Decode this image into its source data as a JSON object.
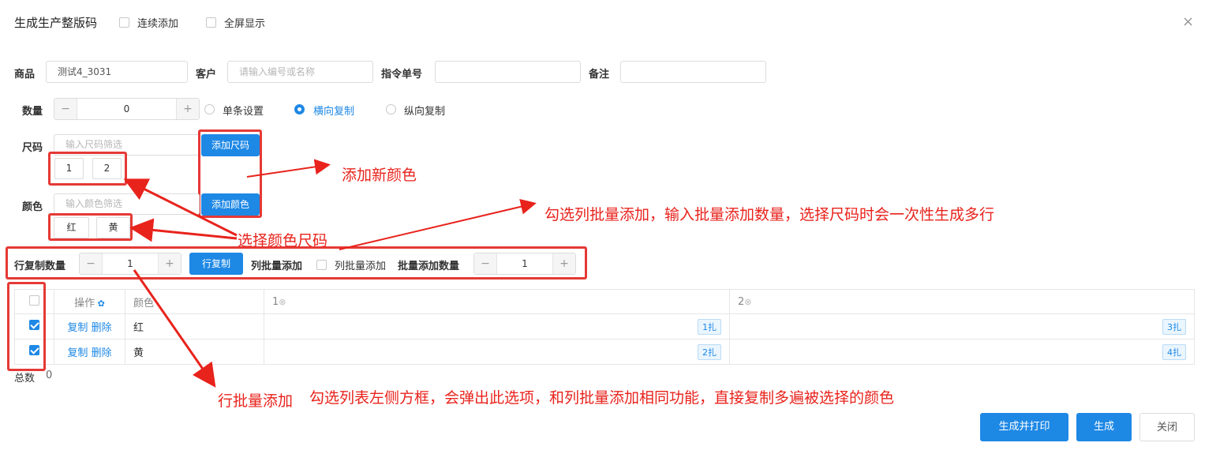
{
  "dialog": {
    "title": "生成生产整版码",
    "continuous_add": "连续添加",
    "fullscreen": "全屏显示",
    "close_icon": "close-icon"
  },
  "form": {
    "product_label": "商品",
    "product_value": "测试4_3031",
    "customer_label": "客户",
    "customer_placeholder": "请输入编号或名称",
    "order_label": "指令单号",
    "remark_label": "备注",
    "qty_label": "数量",
    "qty_value": "0",
    "mode_single": "单条设置",
    "mode_horizontal": "横向复制",
    "mode_vertical": "纵向复制",
    "size_label": "尺码",
    "size_placeholder": "输入尺码筛选",
    "add_size": "添加尺码",
    "sizes": [
      "1",
      "2"
    ],
    "color_label": "颜色",
    "color_placeholder": "输入颜色筛选",
    "add_color": "添加颜色",
    "colors": [
      "红",
      "黄"
    ]
  },
  "batch": {
    "row_copy_label": "行复制数量",
    "row_copy_value": "1",
    "row_copy_btn": "行复制",
    "col_batch_label": "列批量添加",
    "col_batch_check": "列批量添加",
    "batch_qty_label": "批量添加数量",
    "batch_qty_value": "1"
  },
  "table": {
    "headers": {
      "op": "操作",
      "color": "颜色",
      "size1": "1",
      "size2": "2"
    },
    "rows": [
      {
        "copy": "复制",
        "delete": "删除",
        "color": "红",
        "q1": "1扎",
        "q2": "3扎"
      },
      {
        "copy": "复制",
        "delete": "删除",
        "color": "黄",
        "q1": "2扎",
        "q2": "4扎"
      }
    ],
    "total_label": "总数",
    "total_value": "0"
  },
  "footer": {
    "gen_print": "生成并打印",
    "gen": "生成",
    "close": "关闭"
  },
  "annotations": {
    "add_color": "添加新颜色",
    "select": "选择颜色尺码",
    "col_batch": "勾选列批量添加，输入批量添加数量，选择尺码时会一次性生成多行",
    "row_batch": "行批量添加",
    "row_desc": "勾选列表左侧方框，会弹出此选项，和列批量添加相同功能，直接复制多遍被选择的颜色"
  },
  "colors": {
    "accent": "#1e88e5",
    "annotation": "#e8231c"
  }
}
